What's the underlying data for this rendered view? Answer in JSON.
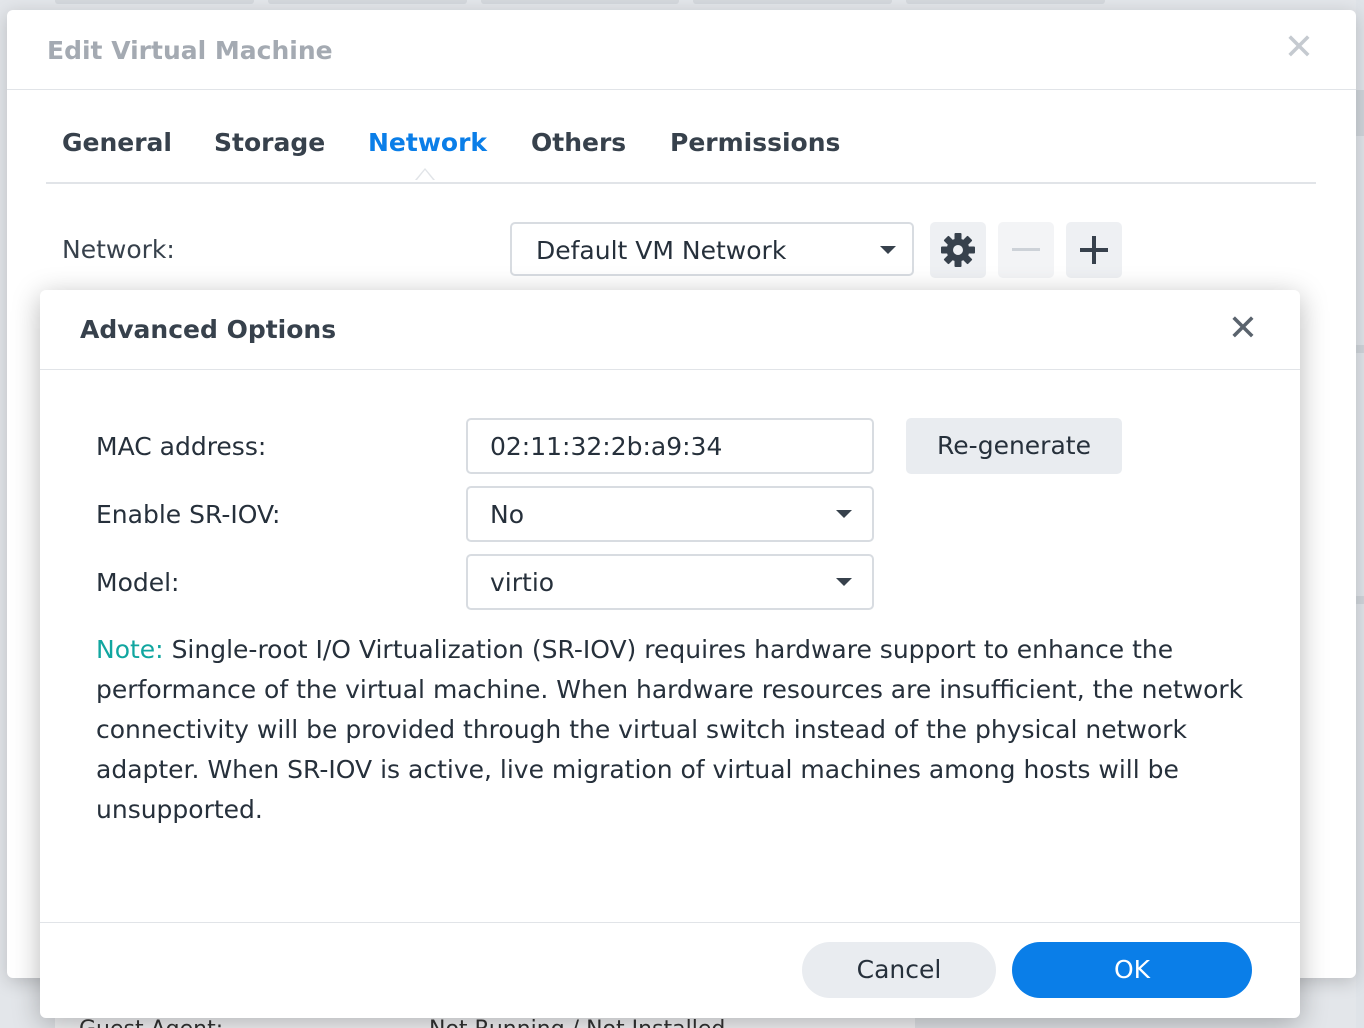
{
  "background": {
    "bottom_row_label": "Guest Agent:",
    "bottom_row_value": "Not Running / Not Installed"
  },
  "edit_window": {
    "title": "Edit Virtual Machine",
    "close_icon": "close-icon",
    "tabs": [
      {
        "label": "General"
      },
      {
        "label": "Storage"
      },
      {
        "label": "Network"
      },
      {
        "label": "Others"
      },
      {
        "label": "Permissions"
      }
    ],
    "active_tab": "Network",
    "network": {
      "label": "Network:",
      "selected": "Default VM Network",
      "settings_icon": "gear-icon",
      "remove_icon": "minus-icon",
      "add_icon": "plus-icon"
    }
  },
  "advanced_options": {
    "title": "Advanced Options",
    "close_icon": "close-icon",
    "mac_label": "MAC address:",
    "mac_value": "02:11:32:2b:a9:34",
    "regenerate_label": "Re-generate",
    "sriov_label": "Enable SR-IOV:",
    "sriov_value": "No",
    "model_label": "Model:",
    "model_value": "virtio",
    "note_prefix": "Note:",
    "note_text": "Single-root I/O Virtualization (SR-IOV) requires hardware support to enhance the performance of the virtual machine. When hardware resources are insufficient, the network connectivity will be provided through the virtual switch instead of the physical network adapter. When SR-IOV is active, live migration of virtual machines among hosts will be unsupported.",
    "cancel_label": "Cancel",
    "ok_label": "OK"
  },
  "colors": {
    "accent": "#0a7ee8",
    "note_accent": "#11a6a0"
  }
}
